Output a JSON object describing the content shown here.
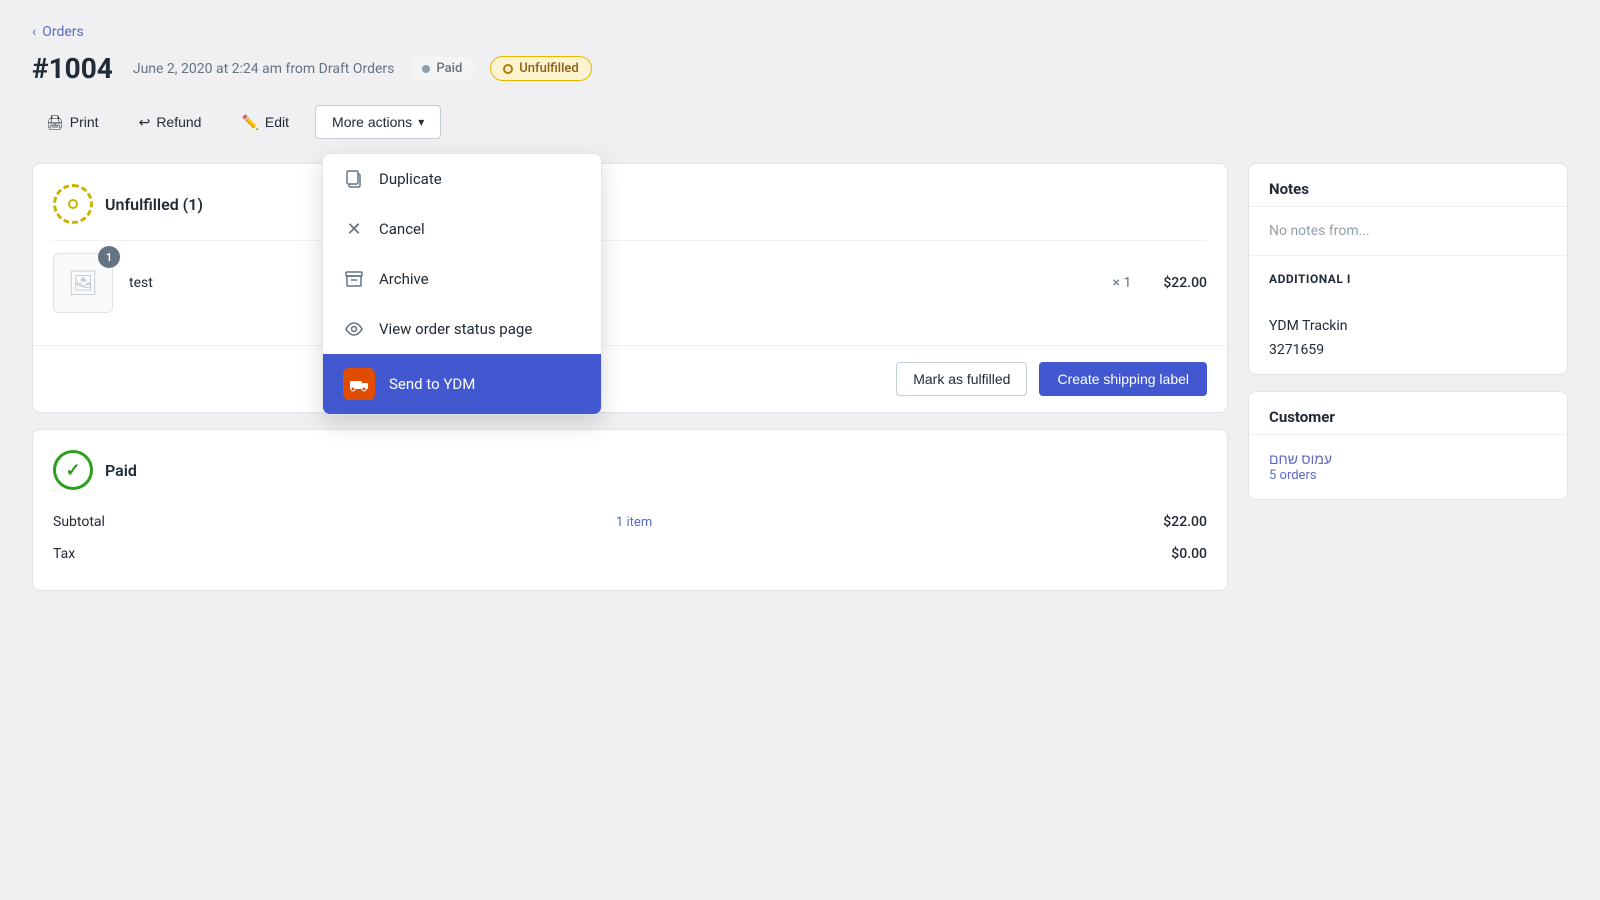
{
  "page": {
    "back_label": "Orders",
    "order_number": "#1004",
    "order_meta": "June 2, 2020 at 2:24 am from Draft Orders",
    "badge_paid": "Paid",
    "badge_unfulfilled": "Unfulfilled"
  },
  "toolbar": {
    "print_label": "Print",
    "refund_label": "Refund",
    "edit_label": "Edit",
    "more_actions_label": "More actions"
  },
  "dropdown": {
    "items": [
      {
        "id": "duplicate",
        "label": "Duplicate",
        "icon": "duplicate"
      },
      {
        "id": "cancel",
        "label": "Cancel",
        "icon": "cancel"
      },
      {
        "id": "archive",
        "label": "Archive",
        "icon": "archive"
      },
      {
        "id": "view-status",
        "label": "View order status page",
        "icon": "eye"
      },
      {
        "id": "send-ydm",
        "label": "Send to YDM",
        "icon": "ydm",
        "active": true
      }
    ]
  },
  "unfulfilled_section": {
    "title": "Unfulfilled (1)",
    "product": {
      "name": "test",
      "quantity": 1,
      "price": "$22.00",
      "image_alt": "product image"
    },
    "mark_fulfilled_label": "Mark as fulfilled",
    "create_shipping_label": "Create shipping label"
  },
  "paid_section": {
    "title": "Paid",
    "subtotal_label": "Subtotal",
    "subtotal_items": "1 item",
    "subtotal_value": "$22.00",
    "tax_label": "Tax",
    "tax_value": "$0.00"
  },
  "notes_section": {
    "title": "Notes",
    "placeholder": "No notes from..."
  },
  "additional_section": {
    "title": "ADDITIONAL I",
    "tracking_label": "YDM Trackin",
    "tracking_value": "3271659"
  },
  "customer_section": {
    "title": "Customer",
    "customer_name": "עמוס שחם",
    "orders_label": "5 orders"
  }
}
